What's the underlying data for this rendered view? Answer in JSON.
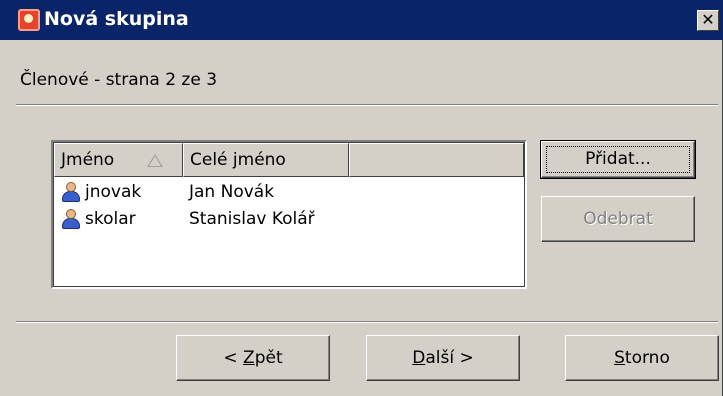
{
  "window": {
    "title": "Nová skupina",
    "close_glyph": "✕",
    "icon": "group-app-icon"
  },
  "page": {
    "subtitle": "Členové - strana 2 ze 3"
  },
  "list": {
    "columns": [
      {
        "label": "Jméno",
        "sorted": "ascending"
      },
      {
        "label": "Celé jméno"
      },
      {
        "label": ""
      }
    ],
    "rows": [
      {
        "icon": "user-icon",
        "login": "jnovak",
        "full_name": "Jan Novák"
      },
      {
        "icon": "user-icon",
        "login": "skolar",
        "full_name": "Stanislav Kolář"
      }
    ]
  },
  "buttons": {
    "add": "Přidat...",
    "remove": "Odebrat",
    "back_prefix": "< ",
    "back_accel": "Z",
    "back_rest": "pět",
    "next_accel": "D",
    "next_rest": "alší >",
    "cancel_accel": "S",
    "cancel_rest": "torno"
  },
  "colors": {
    "titlebar": "#0a246a",
    "face": "#d4d0c8",
    "disabled_text": "#808080"
  }
}
